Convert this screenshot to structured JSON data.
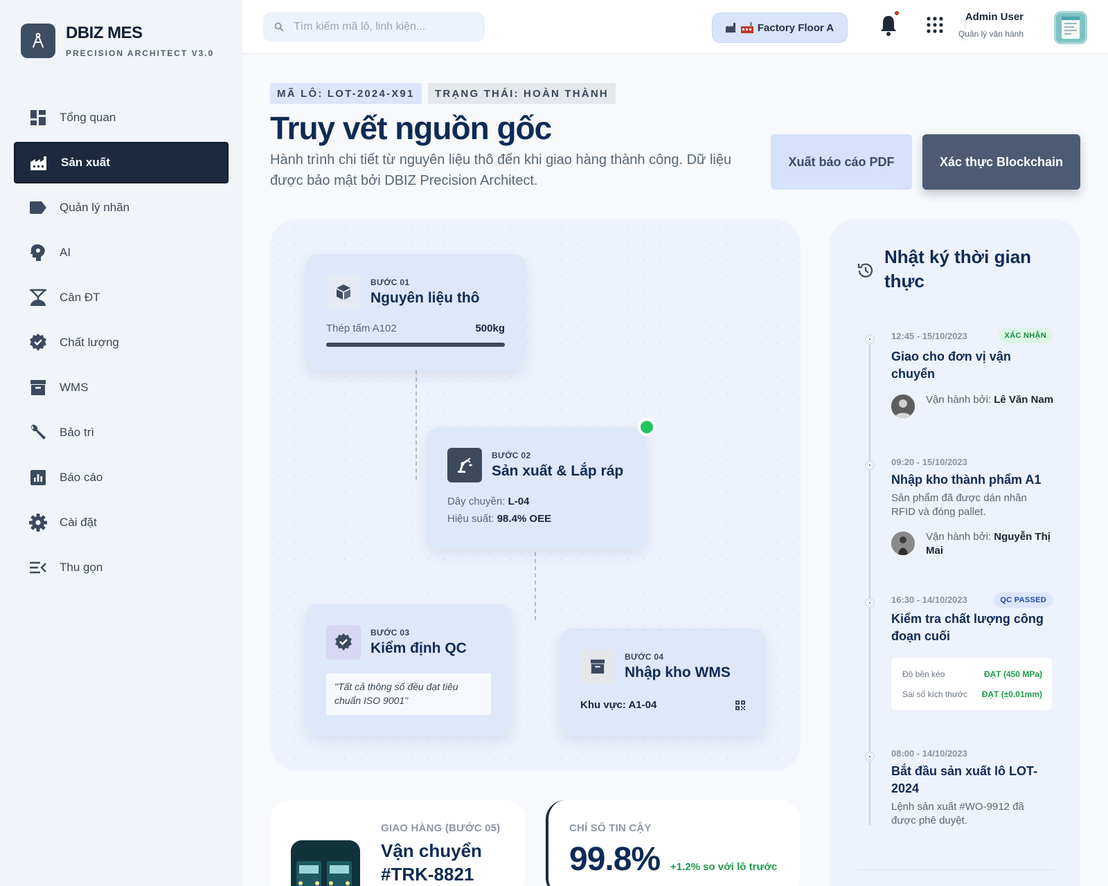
{
  "app": {
    "name": "DBIZ MES",
    "subtitle": "PRECISION ARCHITECT V3.0"
  },
  "sidebar": {
    "items": [
      {
        "label": "Tổng quan",
        "icon": "dashboard-icon",
        "active": false
      },
      {
        "label": "Sản xuất",
        "icon": "factory-icon",
        "active": true
      },
      {
        "label": "Quản lý nhãn",
        "icon": "label-icon",
        "active": false
      },
      {
        "label": "AI",
        "icon": "ai-brain-icon",
        "active": false
      },
      {
        "label": "Cân ĐT",
        "icon": "scale-icon",
        "active": false
      },
      {
        "label": "Chất lượng",
        "icon": "verified-icon",
        "active": false
      },
      {
        "label": "WMS",
        "icon": "archive-icon",
        "active": false
      },
      {
        "label": "Bảo trì",
        "icon": "wrench-icon",
        "active": false
      },
      {
        "label": "Báo cáo",
        "icon": "report-icon",
        "active": false
      },
      {
        "label": "Cài đặt",
        "icon": "gear-icon",
        "active": false
      },
      {
        "label": "Thu gọn",
        "icon": "collapse-icon",
        "active": false
      }
    ]
  },
  "topbar": {
    "search_placeholder": "Tìm kiếm mã lô, linh kiện...",
    "factory_label": "Factory Floor A",
    "user_name": "Admin User",
    "user_role": "Quản lý vận hành"
  },
  "header": {
    "lot_tag": "MÃ LÔ: LOT-2024-X91",
    "status_tag": "TRẠNG THÁI: HOÀN THÀNH",
    "title": "Truy vết nguồn gốc",
    "description": "Hành trình chi tiết từ nguyên liệu thô đến khi giao hàng thành công. Dữ liệu được bảo mật bởi DBIZ Precision Architect.",
    "btn_pdf": "Xuất báo cáo PDF",
    "btn_chain": "Xác thực Blockchain"
  },
  "flow": {
    "step1": {
      "no": "BƯỚC 01",
      "title": "Nguyên liệu thô",
      "material": "Thép tấm A102",
      "qty": "500kg",
      "progress": 1.0
    },
    "step2": {
      "no": "BƯỚC 02",
      "title": "Sản xuất & Lắp ráp",
      "line_label": "Dây chuyền:",
      "line_value": "L-04",
      "perf_label": "Hiệu suất:",
      "perf_value": "98.4% OEE",
      "status_color": "#22c55e"
    },
    "step3": {
      "no": "BƯỚC 03",
      "title": "Kiểm định QC",
      "quote": "\"Tất cả thông số đều đạt tiêu chuẩn ISO 9001\""
    },
    "step4": {
      "no": "BƯỚC 04",
      "title": "Nhập kho WMS",
      "zone": "Khu vực: A1-04"
    }
  },
  "timeline": {
    "title": "Nhật ký thời gian thực",
    "operator_prefix": "Vận hành bởi:",
    "events": [
      {
        "time": "12:45 - 15/10/2023",
        "badge": "XÁC NHẬN",
        "title": "Giao cho đơn vị vận chuyển",
        "operator": "Lê Văn Nam"
      },
      {
        "time": "09:20 - 15/10/2023",
        "title": "Nhập kho thành phẩm A1",
        "text": "Sản phẩm đã được dán nhãn RFID và đóng pallet.",
        "operator": "Nguyễn Thị Mai"
      },
      {
        "time": "16:30 - 14/10/2023",
        "badge": "QC PASSED",
        "title": "Kiểm tra chất lượng công đoạn cuối",
        "checks": [
          {
            "k": "Độ bền kéo",
            "v": "ĐẠT (450 MPa)"
          },
          {
            "k": "Sai số kích thước",
            "v": "ĐẠT (±0.01mm)"
          }
        ]
      },
      {
        "time": "08:00 - 14/10/2023",
        "title": "Bắt đầu sản xuất lô LOT-2024",
        "text": "Lệnh sản xuất #WO-9912 đã được phê duyệt."
      }
    ]
  },
  "bottom": {
    "ship_label": "GIAO HÀNG (BƯỚC 05)",
    "ship_title": "Vận chuyển #TRK-8821",
    "trust_label": "CHỈ SỐ TIN CẬY",
    "trust_value": "99.8%",
    "trust_delta": "+1.2% so với lô trước"
  }
}
